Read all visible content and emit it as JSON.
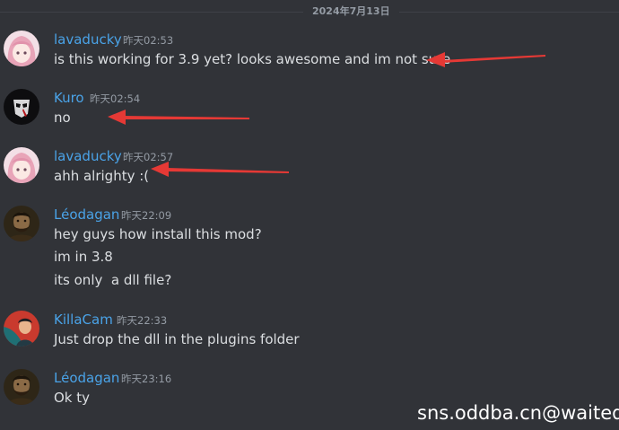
{
  "date_divider": "2024年7月13日",
  "messages": [
    {
      "author": "lavaducky",
      "time": "昨天02:53",
      "lines": [
        "is this working for 3.9 yet? looks awesome and im not sure"
      ]
    },
    {
      "author": "Kuro",
      "time": "昨天02:54",
      "lines": [
        "no"
      ]
    },
    {
      "author": "lavaducky",
      "time": "昨天02:57",
      "lines": [
        "ahh alrighty :("
      ]
    },
    {
      "author": "Léodagan",
      "time": "昨天22:09",
      "lines": [
        "hey guys how install this mod?",
        "im in 3.8",
        "its only  a dll file?"
      ]
    },
    {
      "author": "KillaCam",
      "time": "昨天22:33",
      "lines": [
        "Just drop the dll in the plugins folder"
      ]
    },
    {
      "author": "Léodagan",
      "time": "昨天23:16",
      "lines": [
        "Ok ty"
      ]
    }
  ],
  "watermark": "sns.oddba.cn@waited",
  "colors": {
    "background": "#313338",
    "username": "#4aa3e8",
    "text": "#dbdee1",
    "timestamp": "#949ba4",
    "annotation_arrow": "#e53935"
  }
}
